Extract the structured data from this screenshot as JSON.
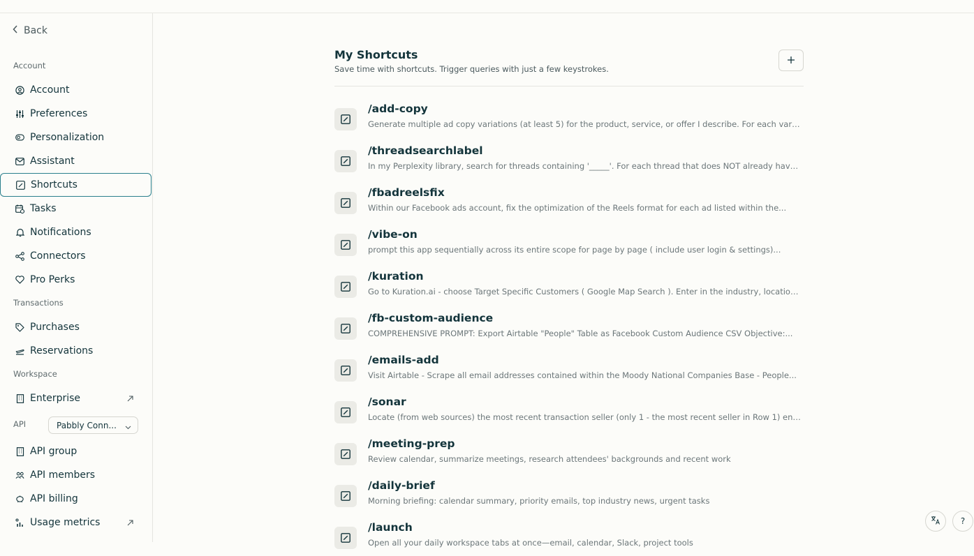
{
  "nav": {
    "back_label": "Back",
    "sections": {
      "account": "Account",
      "transactions": "Transactions",
      "workspace": "Workspace",
      "api": "API"
    },
    "items": [
      {
        "label": "Account",
        "icon": "user-circle-icon"
      },
      {
        "label": "Preferences",
        "icon": "sliders-icon"
      },
      {
        "label": "Personalization",
        "icon": "toggle-icon"
      },
      {
        "label": "Assistant",
        "icon": "mail-icon"
      },
      {
        "label": "Shortcuts",
        "icon": "shortcut-icon",
        "active": true
      },
      {
        "label": "Tasks",
        "icon": "calendar-clock-icon"
      },
      {
        "label": "Notifications",
        "icon": "bell-icon"
      },
      {
        "label": "Connectors",
        "icon": "share-nodes-icon"
      },
      {
        "label": "Pro Perks",
        "icon": "heart-badge-icon"
      },
      {
        "label": "Purchases",
        "icon": "tag-icon"
      },
      {
        "label": "Reservations",
        "icon": "plane-icon"
      },
      {
        "label": "Enterprise",
        "icon": "building-icon"
      },
      {
        "label": "API group",
        "icon": "building-icon"
      },
      {
        "label": "API members",
        "icon": "users-icon"
      },
      {
        "label": "API billing",
        "icon": "piggy-bank-icon"
      },
      {
        "label": "Usage metrics",
        "icon": "bar-chart-icon"
      }
    ],
    "api_select_value": "Pabbly Conn..."
  },
  "main": {
    "title": "My Shortcuts",
    "subtitle": "Save time with shortcuts. Trigger queries with just a few keystrokes.",
    "shortcuts": [
      {
        "name": "/add-copy",
        "desc": "Generate multiple ad copy variations (at least 5) for the product, service, or offer I describe. For each variatio..."
      },
      {
        "name": "/threadsearchlabel",
        "desc": "In my Perplexity library, search for threads containing '_____'. For each thread that does NOT already have a..."
      },
      {
        "name": "/fbadreelsfix",
        "desc": "Within our Facebook ads account, fix the optimization of the Reels format for each ad listed within the..."
      },
      {
        "name": "/vibe-on",
        "desc": "prompt this app sequentially across its entire scope for page by page ( include user login & settings)..."
      },
      {
        "name": "/kuration",
        "desc": "Go to Kuration.ai - choose Target Specific Customers ( Google Map Search ). Enter in the industry, location..."
      },
      {
        "name": "/fb-custom-audience",
        "desc": "COMPREHENSIVE PROMPT: Export Airtable \"People\" Table as Facebook Custom Audience CSV Objective:..."
      },
      {
        "name": "/emails-add",
        "desc": "Visit Airtable - Scrape all email addresses contained within the Moody National Companies Base - People..."
      },
      {
        "name": "/sonar",
        "desc": "Locate (from web sources) the most recent transaction seller (only 1 - the most recent seller in Row 1) entity..."
      },
      {
        "name": "/meeting-prep",
        "desc": "Review calendar, summarize meetings, research attendees' backgrounds and recent work"
      },
      {
        "name": "/daily-brief",
        "desc": "Morning briefing: calendar summary, priority emails, top industry news, urgent tasks"
      },
      {
        "name": "/launch",
        "desc": "Open all your daily workspace tabs at once—email, calendar, Slack, project tools"
      }
    ]
  },
  "floating": {
    "translate_icon": "translate-icon",
    "help_label": "?"
  }
}
